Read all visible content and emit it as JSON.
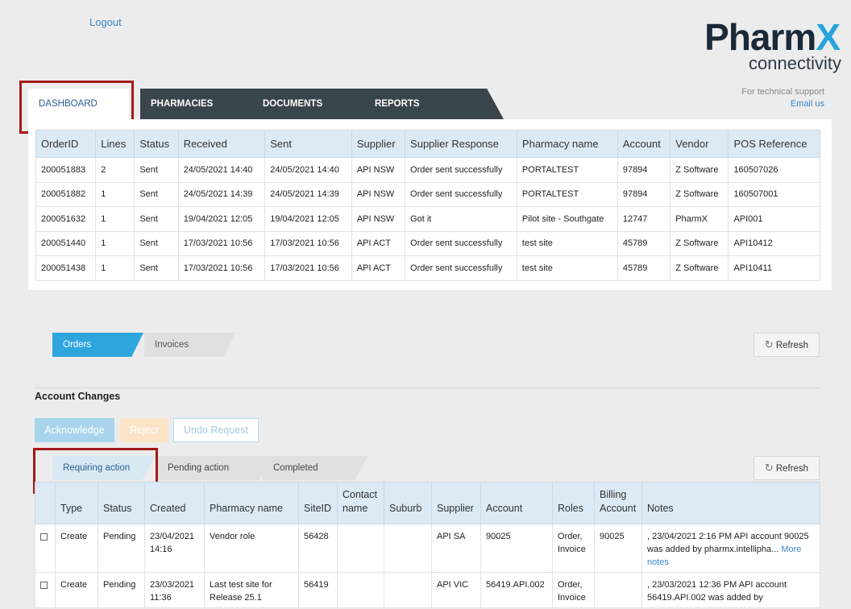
{
  "header": {
    "logout": "Logout",
    "logo_main": "Pharm",
    "logo_x": "X",
    "logo_sub": "connectivity"
  },
  "support": {
    "text": "For technical support",
    "link": "Email us"
  },
  "tabs": {
    "dashboard": "DASHBOARD",
    "pharmacies": "PHARMACIES",
    "documents": "DOCUMENTS",
    "reports": "REPORTS"
  },
  "orders_table": {
    "headers": [
      "OrderID",
      "Lines",
      "Status",
      "Received",
      "Sent",
      "Supplier",
      "Supplier Response",
      "Pharmacy name",
      "Account",
      "Vendor",
      "POS Reference"
    ],
    "rows": [
      [
        "200051883",
        "2",
        "Sent",
        "24/05/2021 14:40",
        "24/05/2021 14:40",
        "API NSW",
        "Order sent successfully",
        "PORTALTEST",
        "97894",
        "Z Software",
        "160507026"
      ],
      [
        "200051882",
        "1",
        "Sent",
        "24/05/2021 14:39",
        "24/05/2021 14:39",
        "API NSW",
        "Order sent successfully",
        "PORTALTEST",
        "97894",
        "Z Software",
        "160507001"
      ],
      [
        "200051632",
        "1",
        "Sent",
        "19/04/2021 12:05",
        "19/04/2021 12:05",
        "API NSW",
        "Got it",
        "Pilot site - Southgate",
        "12747",
        "PharmX",
        "API001"
      ],
      [
        "200051440",
        "1",
        "Sent",
        "17/03/2021 10:56",
        "17/03/2021 10:56",
        "API ACT",
        "Order sent successfully",
        "test site",
        "45789",
        "Z Software",
        "API10412"
      ],
      [
        "200051438",
        "1",
        "Sent",
        "17/03/2021 10:56",
        "17/03/2021 10:56",
        "API ACT",
        "Order sent successfully",
        "test site",
        "45789",
        "Z Software",
        "API10411"
      ]
    ]
  },
  "subtabs1": {
    "orders": "Orders",
    "invoices": "Invoices",
    "refresh": "Refresh"
  },
  "account_changes": {
    "title": "Account Changes",
    "acknowledge": "Acknowledge",
    "reject": "Reject",
    "undo": "Undo Request",
    "tabs": {
      "requiring": "Requiring action",
      "pending": "Pending action",
      "completed": "Completed"
    },
    "refresh": "Refresh",
    "headers": [
      "Type",
      "Status",
      "Created",
      "Pharmacy name",
      "SiteID",
      "Contact name",
      "Suburb",
      "Supplier",
      "Account",
      "Roles",
      "Billing Account",
      "Notes"
    ],
    "rows": [
      {
        "type": "Create",
        "status": "Pending",
        "created": "23/04/2021 14:16",
        "pharmacy": "Vendor role",
        "siteid": "56428",
        "contact": "",
        "suburb": "",
        "supplier": "API SA",
        "account": "90025",
        "roles": "Order, Invoice",
        "billing": "90025",
        "notes": ", 23/04/2021 2:16 PM API account 90025 was added by pharmx.intellipha...",
        "more": "More notes"
      },
      {
        "type": "Create",
        "status": "Pending",
        "created": "23/03/2021 11:36",
        "pharmacy": "Last test site for Release 25.1",
        "siteid": "56419",
        "contact": "",
        "suburb": "",
        "supplier": "API VIC",
        "account": "56419.API.002",
        "roles": "Order, Invoice",
        "billing": "",
        "notes": ", 23/03/2021 12:36 PM API account 56419.API.002 was added by",
        "more": ""
      }
    ]
  },
  "colors": {
    "accent_blue": "#27a4dc",
    "dark_tab": "#3a444b",
    "highlight_red": "#a31a1a",
    "link": "#3a87c8"
  }
}
